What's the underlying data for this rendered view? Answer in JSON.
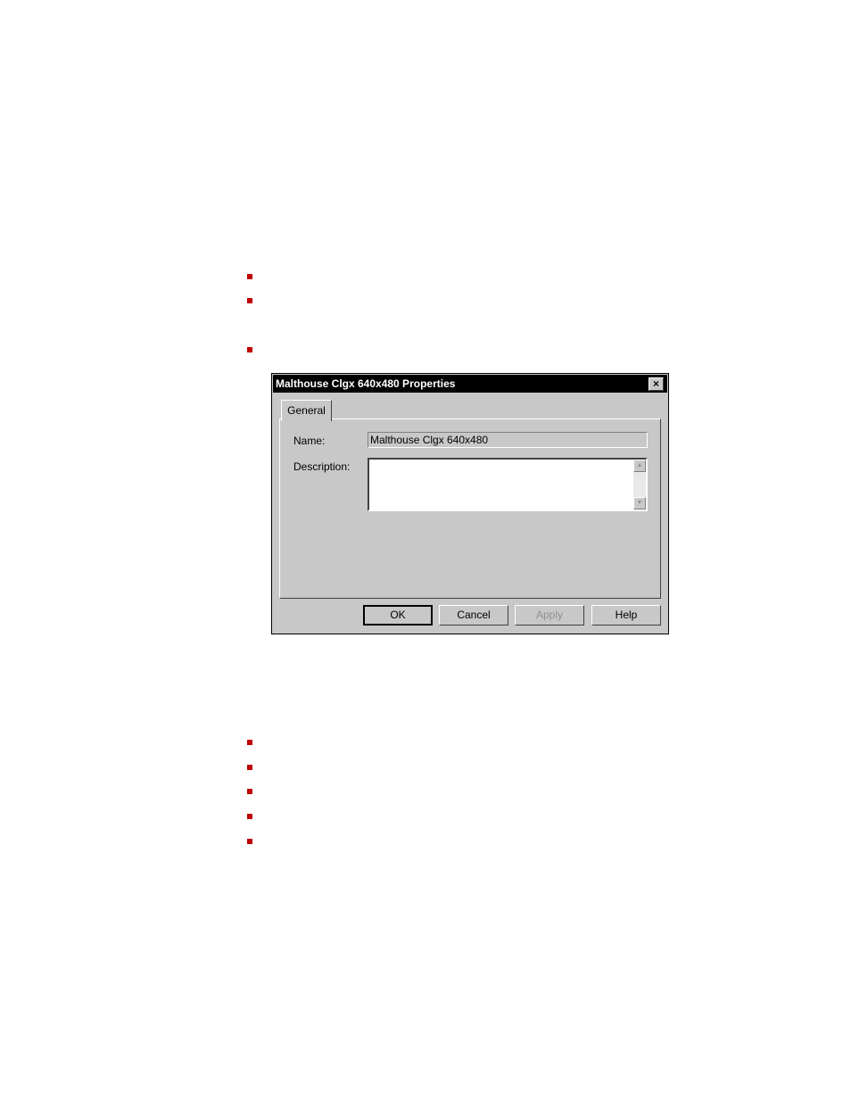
{
  "bullets_top": [
    {
      "color": "#c00000"
    },
    {
      "color": "#c00000"
    },
    {
      "color": "#c00000"
    }
  ],
  "bullets_bottom": [
    {
      "color": "#c00000"
    },
    {
      "color": "#c00000"
    },
    {
      "color": "#c00000"
    },
    {
      "color": "#c00000"
    },
    {
      "color": "#c00000"
    }
  ],
  "dialog": {
    "title": "Malthouse Clgx 640x480 Properties",
    "close_icon": "×",
    "tabs": [
      {
        "label": "General",
        "active": true
      }
    ],
    "fields": {
      "name_label": "Name:",
      "name_value": "Malthouse Clgx 640x480",
      "description_label": "Description:",
      "description_value": ""
    },
    "scroll_up_icon": "▲",
    "scroll_down_icon": "▼",
    "buttons": {
      "ok": "OK",
      "cancel": "Cancel",
      "apply": "Apply",
      "help": "Help"
    }
  }
}
